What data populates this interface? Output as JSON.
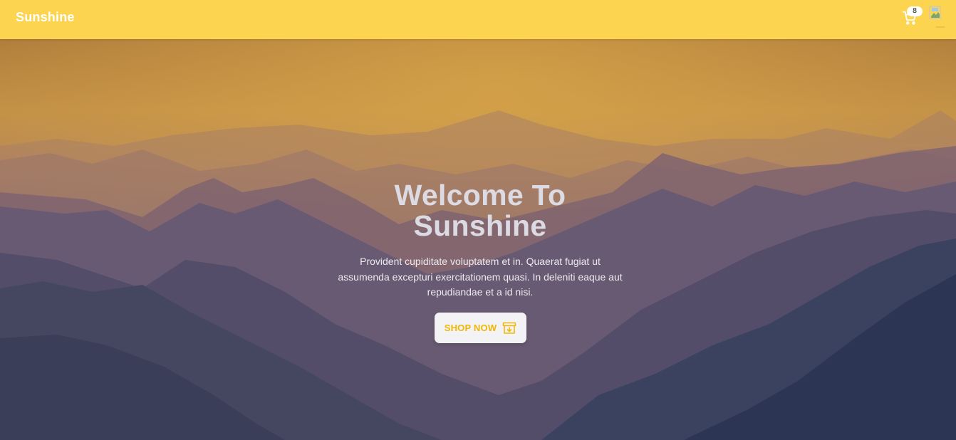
{
  "navbar": {
    "brand": "Sunshine",
    "cart_count": "8",
    "cart_icon": "cart-icon",
    "avatar": "avatar-image",
    "background_color": "#fdd44f"
  },
  "hero": {
    "title_line1": "Welcome To",
    "title_line2": "Sunshine",
    "description": "Provident cupiditate voluptatem et in. Quaerat fugiat ut assumenda excepturi exercitationem quasi. In deleniti eaque aut repudiandae et a id nisi.",
    "cta_label": "SHOP NOW",
    "cta_icon": "archive-download-icon",
    "accent_color": "#f2b705"
  }
}
